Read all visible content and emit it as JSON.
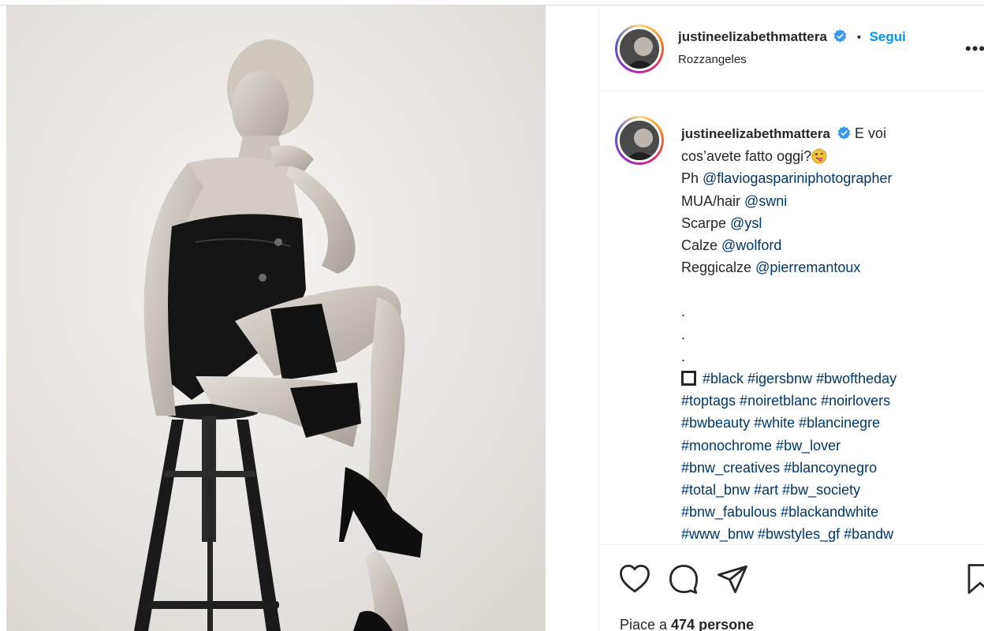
{
  "post": {
    "username": "justineelizabethmattera",
    "follow_label": "Segui",
    "location": "Rozzangeles",
    "caption": {
      "text_after_username": "E voi",
      "line2": "cos’avete fatto oggi?",
      "credits": [
        {
          "prefix": "Ph ",
          "mention": "@flaviogaspariniphotographer"
        },
        {
          "prefix": "MUA/hair ",
          "mention": "@swni"
        },
        {
          "prefix": "Scarpe ",
          "mention": "@ysl"
        },
        {
          "prefix": "Calze ",
          "mention": "@wolford"
        },
        {
          "prefix": "Reggicalze ",
          "mention": "@pierremantoux"
        }
      ],
      "dots": [
        ".",
        ".",
        "."
      ],
      "hashtag_lines": [
        "#black #igersbnw #bwoftheday",
        "#toptags #noiretblanc #noirlovers",
        "#bwbeauty #white #blancinegre",
        "#monochrome #bw_lover",
        "#bnw_creatives #blancoynegro",
        "#total_bnw #art #bw_society",
        "#bnw_fabulous #blackandwhite",
        "#www_bnw #bwstyles_gf #bandw"
      ]
    },
    "likes_prefix": "Piace a ",
    "likes_count": "474 persone"
  },
  "icons": {
    "verified": "verified-badge-icon",
    "more": "more-options-icon",
    "like": "heart-icon",
    "comment": "comment-icon",
    "share": "share-icon",
    "save": "bookmark-icon",
    "emoji": "winking-tongue-emoji",
    "square": "black-square-emoji"
  },
  "colors": {
    "link_blue": "#0095f6",
    "mention_blue": "#00376b",
    "text": "#262626",
    "border": "#efefef"
  }
}
